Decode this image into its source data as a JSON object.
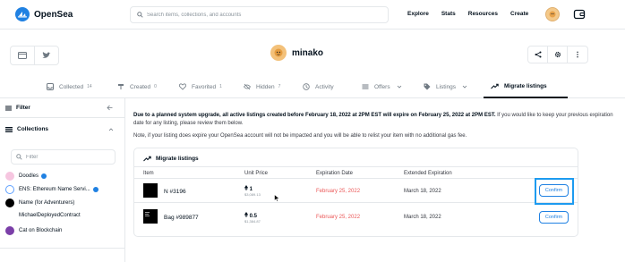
{
  "brand": {
    "name": "OpenSea",
    "color": "#2081e2"
  },
  "search": {
    "placeholder": "Search items, collections, and accounts"
  },
  "nav": {
    "links": [
      "Explore",
      "Stats",
      "Resources",
      "Create"
    ]
  },
  "profile": {
    "name": "minako"
  },
  "tabs": [
    {
      "label": "Collected",
      "count": "14"
    },
    {
      "label": "Created",
      "count": "0"
    },
    {
      "label": "Favorited",
      "count": "1"
    },
    {
      "label": "Hidden",
      "count": "7"
    },
    {
      "label": "Activity"
    },
    {
      "label": "Offers"
    },
    {
      "label": "Listings"
    },
    {
      "label": "Migrate listings"
    }
  ],
  "sidebar": {
    "filter_label": "Filter",
    "collections_label": "Collections",
    "filter_placeholder": "Filter",
    "collections": [
      {
        "name": "Doodles",
        "verified": true,
        "color": "#f6c6e0"
      },
      {
        "name": "ENS: Ethereum Name Servi...",
        "verified": true,
        "color": "#5ea0ff"
      },
      {
        "name": "Name (for Adventurers)",
        "verified": false,
        "color": "#000000"
      },
      {
        "name": "MichaelDeployedContract",
        "verified": false,
        "color": ""
      },
      {
        "name": "Cat on Blockchain",
        "verified": false,
        "color": "#7b3fa8"
      }
    ]
  },
  "notice": {
    "bold": "Due to a planned system upgrade, all active listings created before February 18, 2022 at 2PM EST will expire on February 25, 2022 at 2PM EST.",
    "rest": " If you would like to keep your previous expiration date for any listing, please review them below.",
    "note": "Note, if your listing does expire your OpenSea account will not be impacted and you will be able to relist your item with no additional gas fee."
  },
  "migrate": {
    "title": "Migrate listings",
    "columns": [
      "Item",
      "Unit Price",
      "Expiration Date",
      "Extended Expiration"
    ],
    "rows": [
      {
        "item": "N #3196",
        "price": "1",
        "price_usd": "$3,089.13",
        "expiration": "February 25, 2022",
        "extended": "March 18, 2022",
        "action": "Confirm"
      },
      {
        "item": "Bag #989877",
        "price": "0.5",
        "price_usd": "$1,384.87",
        "expiration": "February 25, 2022",
        "extended": "March 18, 2022",
        "action": "Confirm"
      }
    ]
  }
}
